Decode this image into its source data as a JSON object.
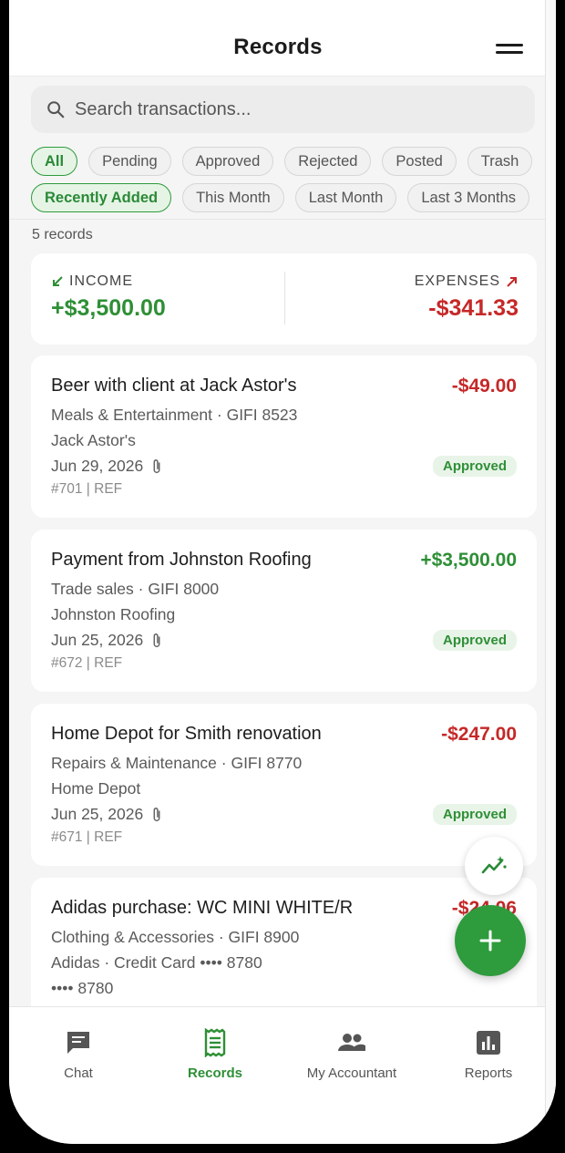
{
  "header": {
    "title": "Records"
  },
  "search": {
    "placeholder": "Search transactions..."
  },
  "filters": {
    "status": [
      "All",
      "Pending",
      "Approved",
      "Rejected",
      "Posted",
      "Trash"
    ],
    "period": [
      "Recently Added",
      "This Month",
      "Last Month",
      "Last 3 Months"
    ]
  },
  "records_count": "5 records",
  "summary": {
    "income_label": "INCOME",
    "income_value": "+$3,500.00",
    "expenses_label": "EXPENSES",
    "expenses_value": "-$341.33"
  },
  "records": [
    {
      "title": "Beer with client at Jack Astor's",
      "amount": "-$49.00",
      "category": "Meals & Entertainment · GIFI 8523",
      "vendor": "Jack Astor's",
      "date": "Jun 29, 2026",
      "ref": "#701 | REF",
      "status": "Approved"
    },
    {
      "title": "Payment from Johnston Roofing",
      "amount": "+$3,500.00",
      "category": "Trade sales · GIFI 8000",
      "vendor": "Johnston Roofing",
      "date": "Jun 25, 2026",
      "ref": "#672 | REF",
      "status": "Approved"
    },
    {
      "title": "Home Depot for Smith renovation",
      "amount": "-$247.00",
      "category": "Repairs & Maintenance · GIFI 8770",
      "vendor": "Home Depot",
      "date": "Jun 25, 2026",
      "ref": "#671 | REF",
      "status": "Approved"
    },
    {
      "title": "Adidas purchase: WC MINI WHITE/R",
      "amount": "-$24.06",
      "category": "Clothing & Accessories · GIFI 8900",
      "vendor": "Adidas · Credit Card •••• 8780",
      "extra": "•••• 8780"
    }
  ],
  "tabs": [
    {
      "label": "Chat",
      "icon": "chat-icon"
    },
    {
      "label": "Records",
      "icon": "receipt-icon"
    },
    {
      "label": "My Accountant",
      "icon": "people-icon"
    },
    {
      "label": "Reports",
      "icon": "bar-chart-icon"
    }
  ],
  "colors": {
    "accent": "#2e9b3c",
    "income": "#2e8f36",
    "expense": "#c62828"
  }
}
